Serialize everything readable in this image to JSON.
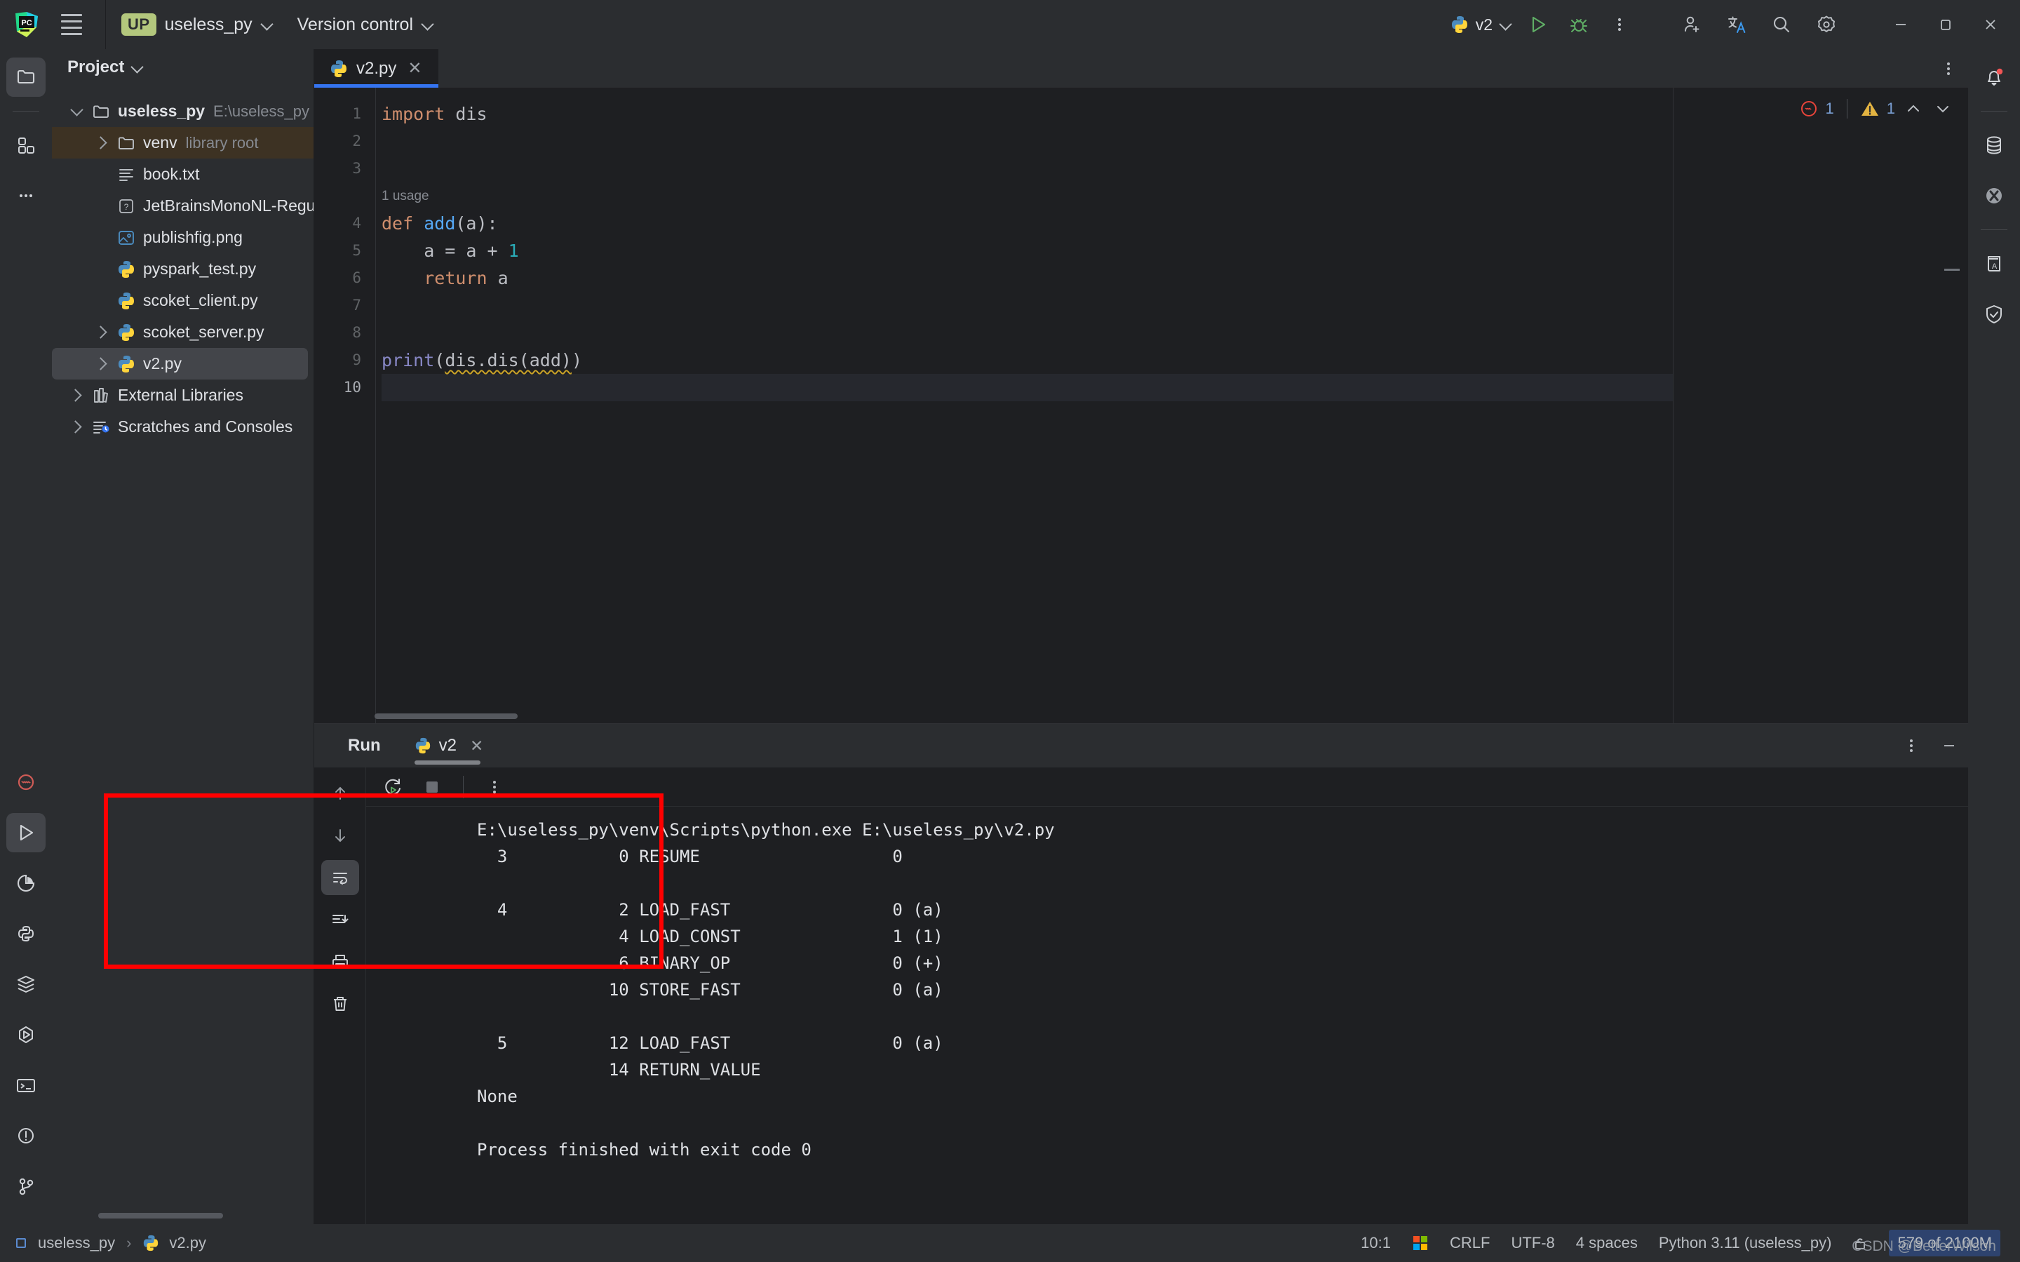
{
  "titlebar": {
    "menu_icon": "hamburger-menu-icon",
    "project_badge": "UP",
    "project_name": "useless_py",
    "version_control": "Version control",
    "run_config": "v2",
    "icons": [
      "run-icon",
      "debug-icon",
      "more-actions-icon",
      "add-collaborator-icon",
      "translate-icon",
      "search-everywhere-icon",
      "settings-icon"
    ],
    "window": {
      "minimize": "–",
      "maximize": "maximize-icon",
      "close": "✕"
    }
  },
  "rail_left": {
    "top": [
      "project-icon",
      "structure-icon",
      "more-tool-windows-icon"
    ],
    "bottom": [
      "problems-icon",
      "run-icon",
      "profiler-icon",
      "python-packages-icon",
      "services-icon",
      "endpoints-icon",
      "terminal-icon",
      "problems-alert-icon",
      "version-control-icon"
    ]
  },
  "rail_right": {
    "items": [
      "notifications-icon",
      "database-icon",
      "big-data-tools-icon",
      "ai-assistant-icon",
      "security-icon"
    ]
  },
  "project_panel": {
    "title": "Project",
    "tree": [
      {
        "indent": 0,
        "twisty": "down",
        "icon": "folder-icon",
        "label": "useless_py",
        "bold": true,
        "sub": "E:\\useless_py",
        "state": ""
      },
      {
        "indent": 1,
        "twisty": "right",
        "icon": "folder-icon",
        "label": "venv",
        "bold": false,
        "sub": "library root",
        "state": "sel-venv"
      },
      {
        "indent": 1,
        "twisty": "none",
        "icon": "text-file-icon",
        "label": "book.txt",
        "bold": false,
        "sub": "",
        "state": ""
      },
      {
        "indent": 1,
        "twisty": "none",
        "icon": "unknown-file-icon",
        "label": "JetBrainsMonoNL-Regula",
        "bold": false,
        "sub": "",
        "state": ""
      },
      {
        "indent": 1,
        "twisty": "none",
        "icon": "image-file-icon",
        "label": "publishfig.png",
        "bold": false,
        "sub": "",
        "state": ""
      },
      {
        "indent": 1,
        "twisty": "none",
        "icon": "python-file-icon",
        "label": "pyspark_test.py",
        "bold": false,
        "sub": "",
        "state": ""
      },
      {
        "indent": 1,
        "twisty": "none",
        "icon": "python-file-icon",
        "label": "scoket_client.py",
        "bold": false,
        "sub": "",
        "state": ""
      },
      {
        "indent": 1,
        "twisty": "right",
        "icon": "python-file-icon",
        "label": "scoket_server.py",
        "bold": false,
        "sub": "",
        "state": ""
      },
      {
        "indent": 1,
        "twisty": "right",
        "icon": "python-file-icon",
        "label": "v2.py",
        "bold": false,
        "sub": "",
        "state": "sel-file"
      },
      {
        "indent": 0,
        "twisty": "right",
        "icon": "external-libraries-icon",
        "label": "External Libraries",
        "bold": false,
        "sub": "",
        "state": ""
      },
      {
        "indent": 0,
        "twisty": "right",
        "icon": "scratches-icon",
        "label": "Scratches and Consoles",
        "bold": false,
        "sub": "",
        "state": ""
      }
    ]
  },
  "editor": {
    "tab": {
      "label": "v2.py",
      "icon": "python-file-icon",
      "close": "✕"
    },
    "more_icon": "editor-options-icon",
    "lines": [
      {
        "num": "1",
        "type": "code",
        "tokens": [
          {
            "t": "import",
            "c": "kw"
          },
          {
            "t": " dis",
            "c": "pl"
          }
        ]
      },
      {
        "num": "2",
        "type": "code",
        "tokens": []
      },
      {
        "num": "3",
        "type": "code",
        "tokens": []
      },
      {
        "num": "",
        "type": "usage",
        "text": "1 usage"
      },
      {
        "num": "4",
        "type": "code",
        "tokens": [
          {
            "t": "def ",
            "c": "kw"
          },
          {
            "t": "add",
            "c": "fn"
          },
          {
            "t": "(a):",
            "c": "pl"
          }
        ]
      },
      {
        "num": "5",
        "type": "code",
        "tokens": [
          {
            "t": "    a = a + ",
            "c": "pl"
          },
          {
            "t": "1",
            "c": "num"
          }
        ]
      },
      {
        "num": "6",
        "type": "code",
        "tokens": [
          {
            "t": "    ",
            "c": "pl"
          },
          {
            "t": "return",
            "c": "kw"
          },
          {
            "t": " a",
            "c": "pl"
          }
        ]
      },
      {
        "num": "7",
        "type": "code",
        "tokens": []
      },
      {
        "num": "8",
        "type": "code",
        "tokens": []
      },
      {
        "num": "9",
        "type": "code",
        "tokens": [
          {
            "t": "print",
            "c": "bi"
          },
          {
            "t": "(",
            "c": "pl"
          },
          {
            "t": "dis.dis(add)",
            "c": "pl squig"
          },
          {
            "t": ")",
            "c": "pl"
          }
        ]
      },
      {
        "num": "10",
        "type": "cur",
        "tokens": []
      }
    ],
    "inspections": {
      "error_count": "1",
      "warning_count": "1",
      "error_icon": "inspection-error-icon",
      "warning_icon": "inspection-warning-icon",
      "prev_icon": "prev-problem-icon",
      "next_icon": "next-problem-icon"
    }
  },
  "run_panel": {
    "title": "Run",
    "tab_label": "v2",
    "tab_icon": "python-file-icon",
    "tab_close": "✕",
    "options_icon": "run-options-icon",
    "minimize_icon": "minimize-tool-window-icon",
    "toolbar": [
      "scroll-up-icon",
      "scroll-down-icon",
      "soft-wrap-icon",
      "scroll-to-end-icon",
      "print-icon",
      "clear-all-icon"
    ],
    "top_toolbar": [
      "rerun-icon",
      "stop-icon",
      "more-icon"
    ],
    "console_lines": [
      "E:\\useless_py\\venv\\Scripts\\python.exe E:\\useless_py\\v2.py",
      "  3           0 RESUME                   0",
      "",
      "  4           2 LOAD_FAST                0 (a)",
      "              4 LOAD_CONST               1 (1)",
      "              6 BINARY_OP                0 (+)",
      "             10 STORE_FAST               0 (a)",
      "",
      "  5          12 LOAD_FAST                0 (a)",
      "             14 RETURN_VALUE",
      "None",
      "",
      "Process finished with exit code 0"
    ],
    "highlight_color": "#ff0000"
  },
  "statusbar": {
    "breadcrumb_project": "useless_py",
    "breadcrumb_sep": "›",
    "breadcrumb_file": "v2.py",
    "caret": "10:1",
    "os_icon": "windows-logo-icon",
    "line_separator": "CRLF",
    "encoding": "UTF-8",
    "indent": "4 spaces",
    "interpreter": "Python 3.11 (useless_py)",
    "lock_icon": "unlocked-icon",
    "memory": "579 of 2100M"
  },
  "watermark": "CSDN @BetterWilson"
}
